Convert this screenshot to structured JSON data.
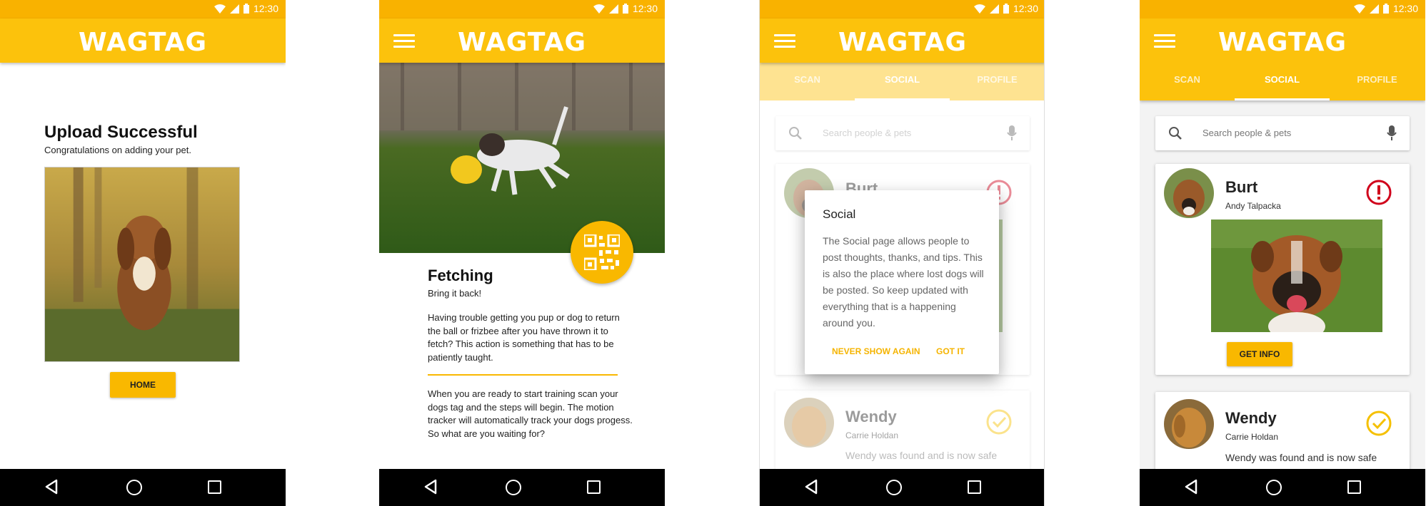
{
  "app": {
    "logo": "WAGTAG",
    "time": "12:30"
  },
  "colors": {
    "primary": "#fcc20c",
    "statusbar": "#f9b200",
    "button": "#f9b800",
    "alert": "#d0021b",
    "ok": "#f5c000"
  },
  "screen1": {
    "title": "Upload Successful",
    "subtitle": "Congratulations on adding your pet.",
    "home_button": "HOME"
  },
  "screen2": {
    "title": "Fetching",
    "subtitle": "Bring it back!",
    "paragraph1": "Having trouble getting you pup or dog to return the ball or frizbee after you have thrown it to fetch? This action is something that has to be patiently taught.",
    "paragraph2": "When you are ready to start training scan your dogs tag and the steps will begin. The motion tracker will automatically track your dogs progess. So what are you waiting for?"
  },
  "tabs": [
    "SCAN",
    "SOCIAL",
    "PROFILE"
  ],
  "search": {
    "placeholder": "Search people & pets"
  },
  "posts": [
    {
      "pet": "Burt",
      "owner": "Andy Talpacka",
      "button": "GET INFO",
      "status_icon": "alert-icon"
    },
    {
      "pet": "Wendy",
      "owner": "Carrie Holdan",
      "message": "Wendy was found and is now safe",
      "status_icon": "check-circle-icon"
    }
  ],
  "dialog": {
    "title": "Social",
    "body": "The Social page allows people to post thoughts, thanks, and tips. This is also the place where lost dogs will be posted. So keep updated with everything that is a happening around you.",
    "dismiss": "NEVER SHOW AGAIN",
    "confirm": "GOT IT"
  },
  "icons": [
    "wifi-icon",
    "signal-icon",
    "battery-icon",
    "menu-icon",
    "search-icon",
    "mic-icon",
    "qr-code-icon",
    "back-icon",
    "home-icon",
    "recents-icon"
  ]
}
